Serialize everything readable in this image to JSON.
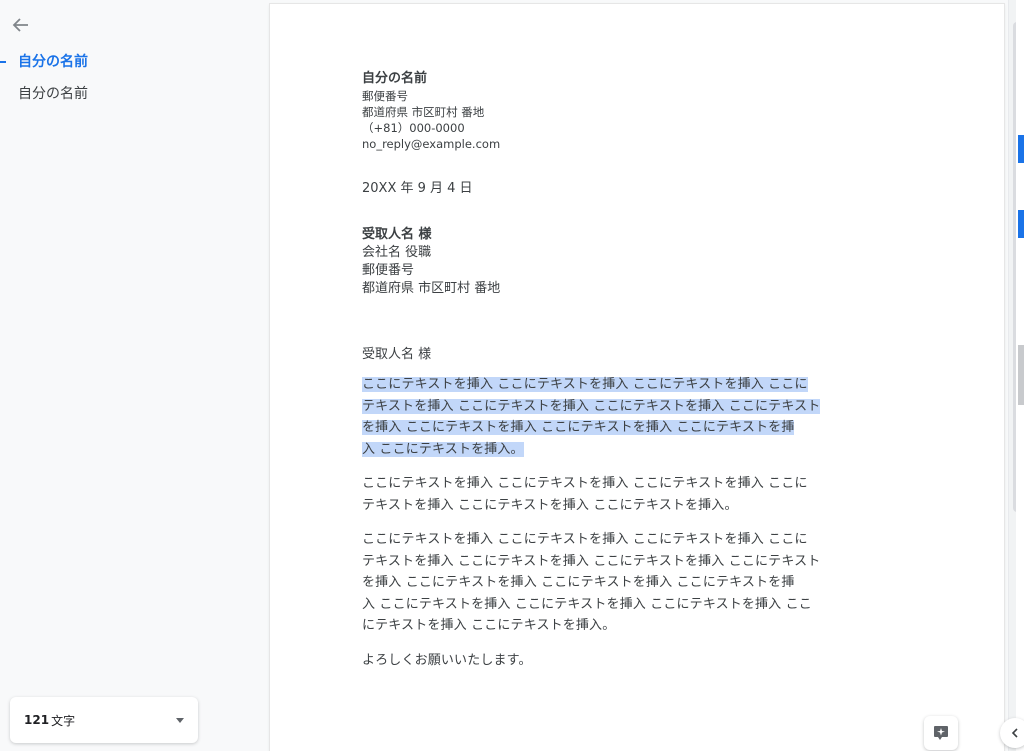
{
  "outline": {
    "items": [
      {
        "label": "自分の名前"
      },
      {
        "label": "自分の名前"
      }
    ]
  },
  "word_count": {
    "count": "121",
    "unit": "文字"
  },
  "document": {
    "sender": {
      "name": "自分の名前",
      "postal": "郵便番号",
      "address": "都道府県 市区町村 番地",
      "phone": "（+81）000-0000",
      "email": "no_reply@example.com"
    },
    "date": "20XX 年 9 月 4 日",
    "recipient": {
      "name": "受取人名 様",
      "company": "会社名 役職",
      "postal": "郵便番号",
      "address": "都道府県 市区町村 番地"
    },
    "salutation": "受取人名 様",
    "paragraphs": [
      [
        "ここにテキストを挿入 ここにテキストを挿入 ここにテキストを挿入 ここに",
        "テキストを挿入 ここにテキストを挿入 ここにテキストを挿入 ここにテキスト",
        "を挿入 ここにテキストを挿入 ここにテキストを挿入 ここにテキストを挿",
        "入 ここにテキストを挿入。"
      ],
      [
        "ここにテキストを挿入 ここにテキストを挿入 ここにテキストを挿入 ここに",
        "テキストを挿入 ここにテキストを挿入 ここにテキストを挿入。"
      ],
      [
        "ここにテキストを挿入 ここにテキストを挿入 ここにテキストを挿入 ここに",
        "テキストを挿入 ここにテキストを挿入 ここにテキストを挿入 ここにテキスト",
        "を挿入 ここにテキストを挿入 ここにテキストを挿入 ここにテキストを挿",
        "入 ここにテキストを挿入 ここにテキストを挿入 ここにテキストを挿入 ここ",
        "にテキストを挿入 ここにテキストを挿入。"
      ]
    ],
    "closing": "よろしくお願いいたします。"
  },
  "colors": {
    "accent": "#1a73e8",
    "selection": "#c2d7f9",
    "text": "#3c4043"
  },
  "icons": {
    "back": "arrow-left-icon",
    "dropdown": "caret-down-icon",
    "explore": "explore-sparkle-icon",
    "collapse": "chevron-left-icon"
  }
}
